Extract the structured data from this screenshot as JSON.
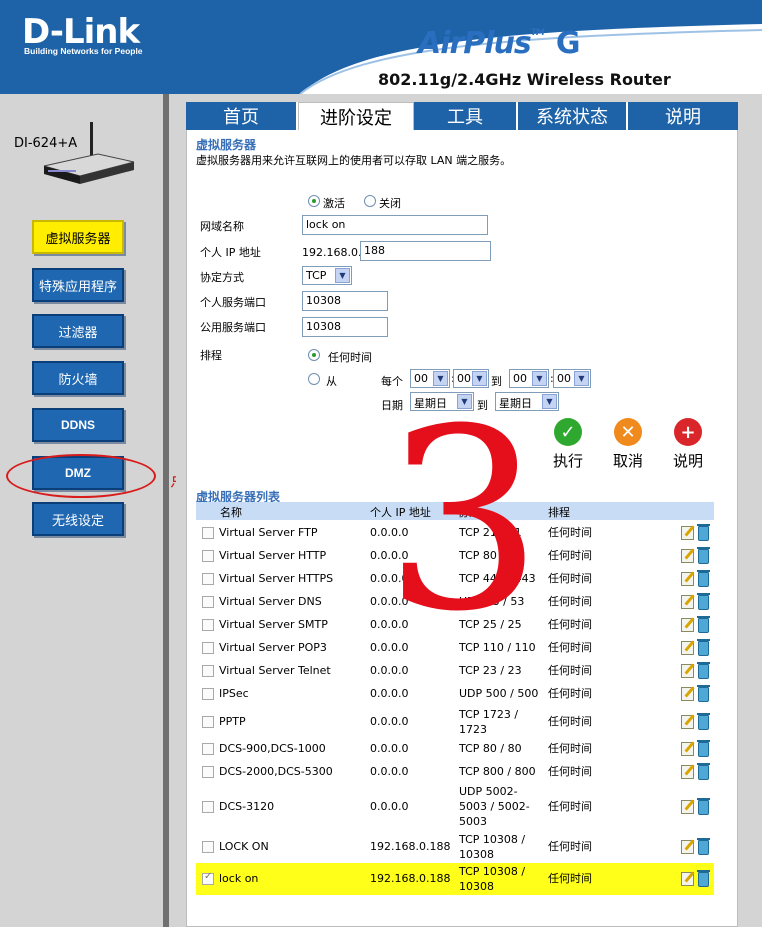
{
  "header": {
    "logo_main": "D-Link",
    "logo_sub": "Building Networks for People",
    "brand": "AirPlus",
    "brand_mark": "TM",
    "brand_letter": "G",
    "model_title": "802.11g/2.4GHz Wireless Router"
  },
  "device": {
    "label": "DI-624+A"
  },
  "tabs": [
    {
      "label": "首页"
    },
    {
      "label": "进阶设定"
    },
    {
      "label": "工具"
    },
    {
      "label": "系统状态"
    },
    {
      "label": "说明"
    }
  ],
  "sidebar": {
    "items": [
      {
        "label": "虚拟服务器"
      },
      {
        "label": "特殊应用程序"
      },
      {
        "label": "过滤器"
      },
      {
        "label": "防火墙"
      },
      {
        "label": "DDNS"
      },
      {
        "label": "DMZ"
      },
      {
        "label": "无线设定"
      }
    ],
    "annotation": "点击"
  },
  "form": {
    "title": "虚拟服务器",
    "description": "虚拟服务器用来允许互联网上的使用者可以存取 LAN 端之服务。",
    "enable_label": "激活",
    "disable_label": "关闭",
    "name_label": "网域名称",
    "name_value": "lock on",
    "ip_label": "个人 IP 地址",
    "ip_prefix": "192.168.0.",
    "ip_value": "188",
    "protocol_label": "协定方式",
    "protocol_value": "TCP",
    "private_port_label": "个人服务端口",
    "private_port_value": "10308",
    "public_port_label": "公用服务端口",
    "public_port_value": "10308",
    "schedule_label": "排程",
    "schedule_always": "任何时间",
    "schedule_from": "从",
    "every_label": "每个",
    "to_label": "到",
    "time_h1": "00",
    "time_m1": "00",
    "time_h2": "00",
    "time_m2": "00",
    "date_label": "日期",
    "day1": "星期日",
    "day2": "星期日"
  },
  "actions": {
    "apply": "执行",
    "cancel": "取消",
    "help": "说明"
  },
  "overlay_number": "3",
  "list": {
    "title": "虚拟服务器列表",
    "columns": [
      "名称",
      "个人 IP 地址",
      "协定",
      "排程"
    ],
    "rows": [
      {
        "name": "Virtual Server FTP",
        "ip": "0.0.0.0",
        "proto": "TCP 21 / 21",
        "sched": "任何时间"
      },
      {
        "name": "Virtual Server HTTP",
        "ip": "0.0.0.0",
        "proto": "TCP 80 / 80",
        "sched": "任何时间"
      },
      {
        "name": "Virtual Server HTTPS",
        "ip": "0.0.0.0",
        "proto": "TCP 443 / 443",
        "sched": "任何时间"
      },
      {
        "name": "Virtual Server DNS",
        "ip": "0.0.0.0",
        "proto": "UDP 53 / 53",
        "sched": "任何时间"
      },
      {
        "name": "Virtual Server SMTP",
        "ip": "0.0.0.0",
        "proto": "TCP 25 / 25",
        "sched": "任何时间"
      },
      {
        "name": "Virtual Server POP3",
        "ip": "0.0.0.0",
        "proto": "TCP 110 / 110",
        "sched": "任何时间"
      },
      {
        "name": "Virtual Server Telnet",
        "ip": "0.0.0.0",
        "proto": "TCP 23 / 23",
        "sched": "任何时间"
      },
      {
        "name": "IPSec",
        "ip": "0.0.0.0",
        "proto": "UDP 500 / 500",
        "sched": "任何时间"
      },
      {
        "name": "PPTP",
        "ip": "0.0.0.0",
        "proto": "TCP 1723 / 1723",
        "sched": "任何时间"
      },
      {
        "name": "DCS-900,DCS-1000",
        "ip": "0.0.0.0",
        "proto": "TCP 80 / 80",
        "sched": "任何时间"
      },
      {
        "name": "DCS-2000,DCS-5300",
        "ip": "0.0.0.0",
        "proto": "TCP 800 / 800",
        "sched": "任何时间"
      },
      {
        "name": "DCS-3120",
        "ip": "0.0.0.0",
        "proto": "UDP 5002-5003 / 5002-5003",
        "sched": "任何时间"
      },
      {
        "name": "LOCK ON",
        "ip": "192.168.0.188",
        "proto": "TCP 10308 / 10308",
        "sched": "任何时间"
      },
      {
        "name": "lock on",
        "ip": "192.168.0.188",
        "proto": "TCP 10308 / 10308",
        "sched": "任何时间"
      }
    ]
  },
  "colors": {
    "header_blue": "#1e63a8",
    "active_yellow": "#ffee00",
    "annotation_red": "#e50f1c"
  }
}
